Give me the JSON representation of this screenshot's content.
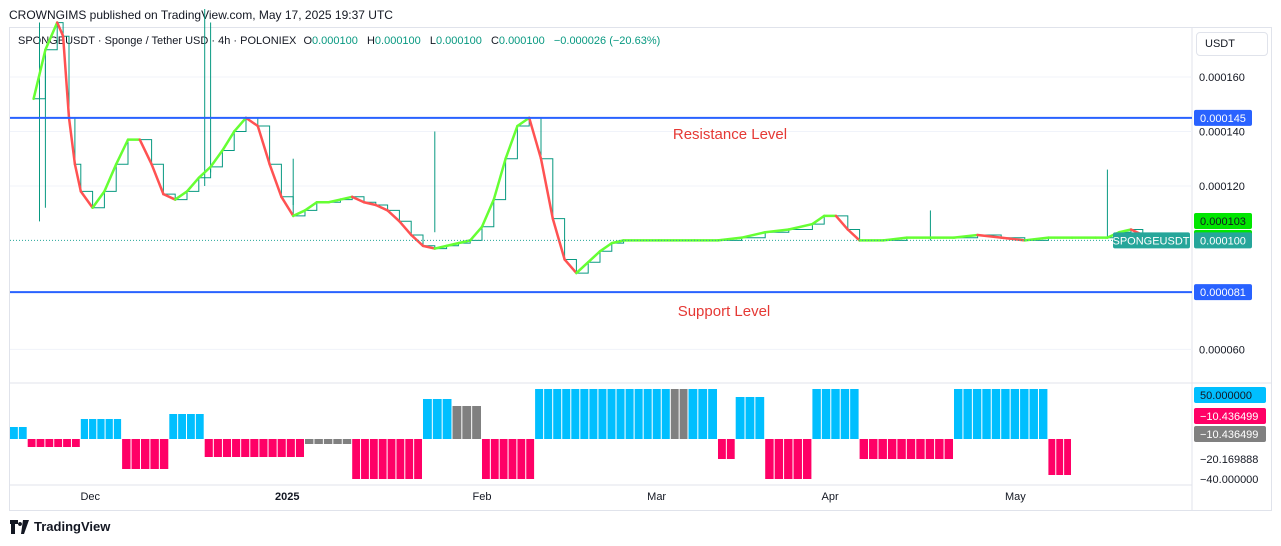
{
  "header": {
    "publisher_line": "CROWNGIMS published on TradingView.com, May 17, 2025 19:37 UTC"
  },
  "legend": {
    "symbol": "SPONGEUSDT · Sponge / Tether USD · 4h · POLONIEX",
    "o_label": "O",
    "o_value": "0.000100",
    "h_label": "H",
    "h_value": "0.000100",
    "l_label": "L",
    "l_value": "0.000100",
    "c_label": "C",
    "c_value": "0.000100",
    "change": "−0.000026 (−20.63%)"
  },
  "price_axis": {
    "currency": "USDT"
  },
  "annotations": {
    "resistance": "Resistance Level",
    "support": "Support Level"
  },
  "footer": {
    "brand": "TradingView"
  },
  "colors": {
    "up": "#66ff33",
    "down": "#ff5252",
    "level": "#2962ff",
    "osc_pos": "#00bfff",
    "osc_neg": "#ff0066",
    "osc_neutral": "#808080"
  },
  "chart_data": [
    {
      "type": "line",
      "title": "SPONGEUSDT · Sponge / Tether USD · 4h · POLONIEX",
      "x_ticks": [
        "Dec",
        "2025",
        "Feb",
        "Mar",
        "Apr",
        "May"
      ],
      "y_ticks": [
        "0.000160",
        "0.000140",
        "0.000120",
        "0.000060"
      ],
      "ylim": [
        4.8e-05,
        0.000178
      ],
      "price_labels": [
        {
          "text": "0.000145",
          "value": 0.000145,
          "color": "#2962ff"
        },
        {
          "text": "0.000103",
          "value": 0.000103,
          "color": "#00e600"
        },
        {
          "text": "0.000103",
          "value": 0.000103,
          "color": "#00e600"
        },
        {
          "text": "0.000100",
          "value": 0.0001,
          "color": "#26a69a"
        },
        {
          "text": "0.000081",
          "value": 8.1e-05,
          "color": "#2962ff"
        }
      ],
      "symbol_tag": "SPONGEUSDT",
      "levels": [
        {
          "name": "Resistance Level",
          "value": 0.000145
        },
        {
          "name": "Support Level",
          "value": 8.1e-05
        }
      ],
      "series": [
        {
          "values": [
            [
              0.02,
              0.000152
            ],
            [
              0.03,
              0.00017
            ],
            [
              0.04,
              0.00018
            ],
            [
              0.045,
              0.000175
            ],
            [
              0.05,
              0.000145
            ],
            [
              0.055,
              0.000128
            ],
            [
              0.06,
              0.000118
            ],
            [
              0.07,
              0.000112
            ],
            [
              0.08,
              0.000118
            ],
            [
              0.09,
              0.000128
            ],
            [
              0.1,
              0.000137
            ],
            [
              0.11,
              0.000137
            ],
            [
              0.12,
              0.000128
            ],
            [
              0.13,
              0.000117
            ],
            [
              0.14,
              0.000115
            ],
            [
              0.15,
              0.000118
            ],
            [
              0.16,
              0.000123
            ],
            [
              0.17,
              0.000127
            ],
            [
              0.18,
              0.000133
            ],
            [
              0.19,
              0.00014
            ],
            [
              0.2,
              0.000145
            ],
            [
              0.21,
              0.000142
            ],
            [
              0.22,
              0.000128
            ],
            [
              0.23,
              0.000116
            ],
            [
              0.24,
              0.000109
            ],
            [
              0.25,
              0.000111
            ],
            [
              0.26,
              0.000114
            ],
            [
              0.27,
              0.000114
            ],
            [
              0.28,
              0.000115
            ],
            [
              0.29,
              0.000116
            ],
            [
              0.3,
              0.000114
            ],
            [
              0.31,
              0.000113
            ],
            [
              0.32,
              0.000111
            ],
            [
              0.33,
              0.000107
            ],
            [
              0.34,
              0.000102
            ],
            [
              0.35,
              9.8e-05
            ],
            [
              0.36,
              9.7e-05
            ],
            [
              0.37,
              9.8e-05
            ],
            [
              0.38,
              9.9e-05
            ],
            [
              0.39,
              0.0001
            ],
            [
              0.4,
              0.000105
            ],
            [
              0.41,
              0.000115
            ],
            [
              0.42,
              0.00013
            ],
            [
              0.43,
              0.000142
            ],
            [
              0.44,
              0.000145
            ],
            [
              0.45,
              0.00013
            ],
            [
              0.46,
              0.000108
            ],
            [
              0.47,
              9.3e-05
            ],
            [
              0.48,
              8.8e-05
            ],
            [
              0.49,
              9.2e-05
            ],
            [
              0.5,
              9.6e-05
            ],
            [
              0.51,
              9.9e-05
            ],
            [
              0.52,
              0.0001
            ],
            [
              0.55,
              0.0001
            ],
            [
              0.58,
              0.0001
            ],
            [
              0.6,
              0.0001
            ],
            [
              0.62,
              0.000101
            ],
            [
              0.64,
              0.000103
            ],
            [
              0.66,
              0.000104
            ],
            [
              0.68,
              0.000106
            ],
            [
              0.69,
              0.000109
            ],
            [
              0.7,
              0.000109
            ],
            [
              0.71,
              0.000104
            ],
            [
              0.72,
              0.0001
            ],
            [
              0.74,
              0.0001
            ],
            [
              0.76,
              0.000101
            ],
            [
              0.78,
              0.000101
            ],
            [
              0.8,
              0.000101
            ],
            [
              0.82,
              0.000102
            ],
            [
              0.84,
              0.000101
            ],
            [
              0.86,
              0.0001
            ],
            [
              0.88,
              0.000101
            ],
            [
              0.9,
              0.000101
            ],
            [
              0.92,
              0.000101
            ],
            [
              0.93,
              0.000101
            ],
            [
              0.94,
              0.000103
            ],
            [
              0.95,
              0.000104
            ],
            [
              0.96,
              0.000102
            ],
            [
              0.97,
              0.0001
            ]
          ]
        }
      ]
    },
    {
      "type": "bar",
      "y_ticks": [
        "50.000000",
        "−10.436499",
        "−10.436499",
        "−20.169888",
        "−40.000000"
      ],
      "ylim": [
        -45,
        55
      ],
      "highlighted_ticks": [
        {
          "text": "50.000000",
          "color": "#00bfff"
        },
        {
          "text": "−10.436499",
          "color": "#ff0066"
        },
        {
          "text": "−10.436499",
          "color": "#808080"
        }
      ],
      "segments": [
        {
          "from": 0.0,
          "to": 0.015,
          "value": 12,
          "class": "pos"
        },
        {
          "from": 0.015,
          "to": 0.06,
          "value": -8,
          "class": "neg"
        },
        {
          "from": 0.06,
          "to": 0.095,
          "value": 20,
          "class": "pos"
        },
        {
          "from": 0.095,
          "to": 0.135,
          "value": -30,
          "class": "neg"
        },
        {
          "from": 0.135,
          "to": 0.165,
          "value": 25,
          "class": "pos"
        },
        {
          "from": 0.165,
          "to": 0.25,
          "value": -18,
          "class": "neg"
        },
        {
          "from": 0.25,
          "to": 0.29,
          "value": -5,
          "class": "neutral"
        },
        {
          "from": 0.29,
          "to": 0.35,
          "value": -40,
          "class": "neg"
        },
        {
          "from": 0.35,
          "to": 0.375,
          "value": 40,
          "class": "pos"
        },
        {
          "from": 0.375,
          "to": 0.4,
          "value": 33,
          "class": "neutral"
        },
        {
          "from": 0.4,
          "to": 0.445,
          "value": -40,
          "class": "neg"
        },
        {
          "from": 0.445,
          "to": 0.56,
          "value": 50,
          "class": "pos"
        },
        {
          "from": 0.56,
          "to": 0.575,
          "value": 50,
          "class": "neutral"
        },
        {
          "from": 0.575,
          "to": 0.6,
          "value": 50,
          "class": "pos"
        },
        {
          "from": 0.6,
          "to": 0.615,
          "value": -20,
          "class": "neg"
        },
        {
          "from": 0.615,
          "to": 0.64,
          "value": 42,
          "class": "pos"
        },
        {
          "from": 0.64,
          "to": 0.68,
          "value": -40,
          "class": "neg"
        },
        {
          "from": 0.68,
          "to": 0.72,
          "value": 50,
          "class": "pos"
        },
        {
          "from": 0.72,
          "to": 0.8,
          "value": -20,
          "class": "neg"
        },
        {
          "from": 0.8,
          "to": 0.88,
          "value": 50,
          "class": "pos"
        },
        {
          "from": 0.88,
          "to": 0.9,
          "value": -36,
          "class": "neg"
        }
      ]
    }
  ]
}
